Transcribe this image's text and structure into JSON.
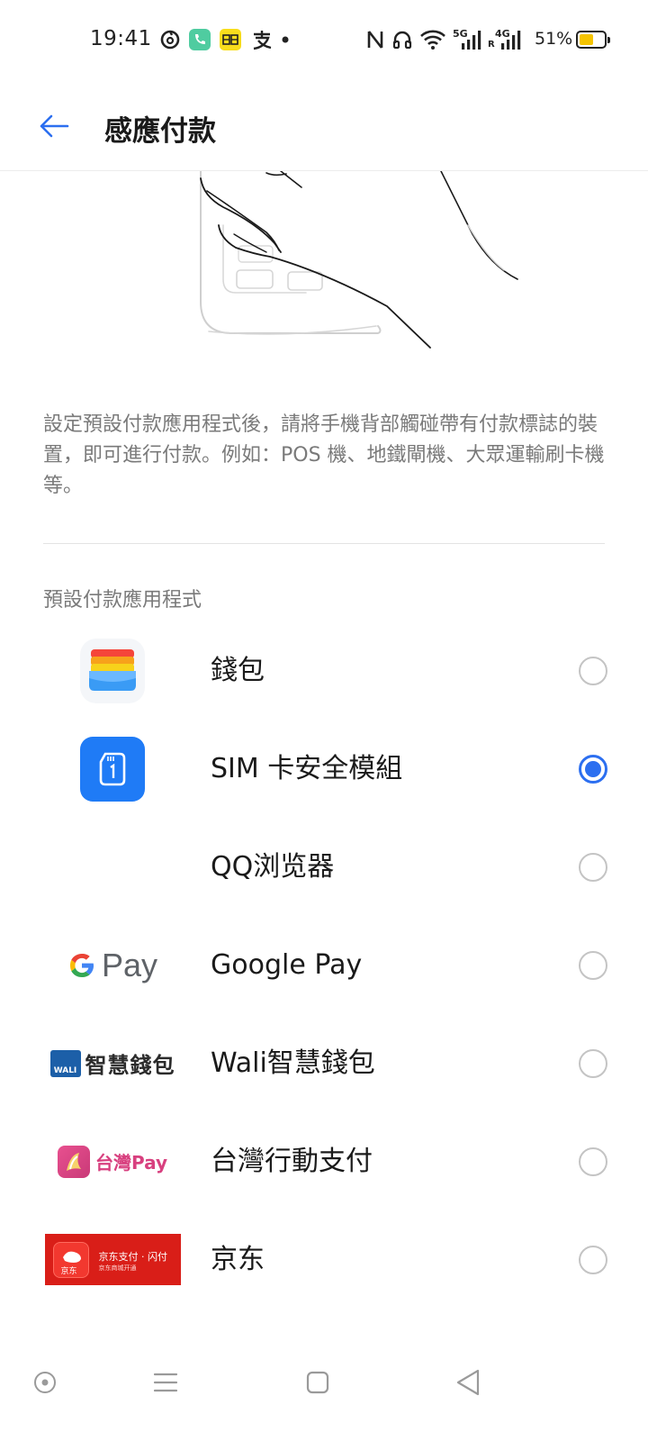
{
  "status_bar": {
    "time": "19:41",
    "network_5g": "5G",
    "network_4g": "4G",
    "roaming": "R",
    "battery_percent": "51%",
    "battery_level": 0.51,
    "icons": [
      "netease-cloud-music-icon",
      "phone-call-icon",
      "simcard-app-icon",
      "alipay-icon",
      "dot-icon",
      "nfc-icon",
      "headset-icon",
      "wifi-icon",
      "signal-5g-icon",
      "signal-4g-icon",
      "battery-icon"
    ]
  },
  "header": {
    "back_icon": "arrow-left-icon",
    "title": "感應付款"
  },
  "description": "設定預設付款應用程式後，請將手機背部觸碰帶有付款標誌的裝置，即可進行付款。例如：POS 機、地鐵閘機、大眾運輸刷卡機等。",
  "section_header": "預設付款應用程式",
  "payment_apps": [
    {
      "label": "錢包",
      "icon": "wallet-icon",
      "selected": false
    },
    {
      "label": "SIM 卡安全模組",
      "icon": "sim-card-icon",
      "selected": true
    },
    {
      "label": "QQ浏览器",
      "icon": "none",
      "selected": false
    },
    {
      "label": "Google Pay",
      "icon": "google-pay-icon",
      "icon_text": "Pay",
      "selected": false
    },
    {
      "label": "Wali智慧錢包",
      "icon": "wali-wallet-icon",
      "icon_text": "智慧錢包",
      "icon_badge_text": "WALI",
      "selected": false
    },
    {
      "label": "台灣行動支付",
      "icon": "taiwan-pay-icon",
      "icon_text": "台灣Pay",
      "selected": false
    },
    {
      "label": "京东",
      "icon": "jd-pay-banner-icon",
      "icon_text": "京东支付 · 闪付",
      "icon_subtext": "京东商城开通",
      "icon_logo_text": "京东",
      "selected": false
    }
  ],
  "colors": {
    "accent": "#2c6ff0",
    "text_primary": "#1a1a1a",
    "text_secondary": "#7a7a7a",
    "divider": "#e3e3e3",
    "back_arrow": "#2c6ff0"
  },
  "nav_bar": {
    "icons": [
      "assistant-dot-icon",
      "menu-lines-icon",
      "home-square-icon",
      "back-triangle-icon"
    ]
  }
}
